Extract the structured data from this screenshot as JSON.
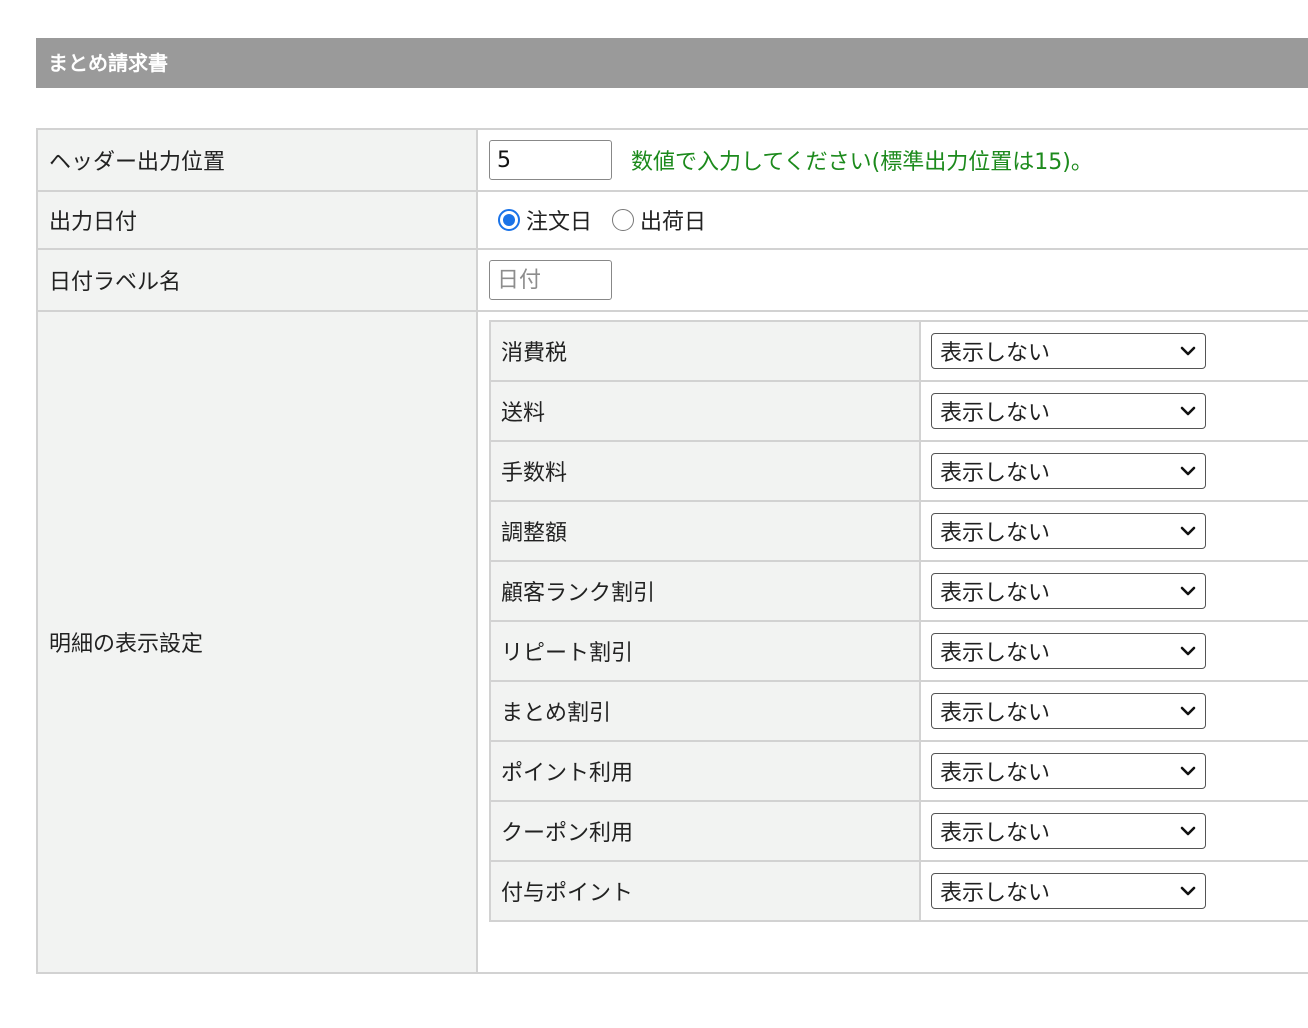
{
  "section": {
    "title": "まとめ請求書"
  },
  "header_position": {
    "label": "ヘッダー出力位置",
    "value": "5",
    "hint": "数値で入力してください(標準出力位置は15)。"
  },
  "output_date": {
    "label": "出力日付",
    "options": [
      {
        "label": "注文日",
        "checked": true
      },
      {
        "label": "出荷日",
        "checked": false
      }
    ]
  },
  "date_label_name": {
    "label": "日付ラベル名",
    "placeholder": "日付"
  },
  "detail_display": {
    "label": "明細の表示設定",
    "items": [
      {
        "label": "消費税",
        "selected": "表示しない"
      },
      {
        "label": "送料",
        "selected": "表示しない"
      },
      {
        "label": "手数料",
        "selected": "表示しない"
      },
      {
        "label": "調整額",
        "selected": "表示しない"
      },
      {
        "label": "顧客ランク割引",
        "selected": "表示しない"
      },
      {
        "label": "リピート割引",
        "selected": "表示しない"
      },
      {
        "label": "まとめ割引",
        "selected": "表示しない"
      },
      {
        "label": "ポイント利用",
        "selected": "表示しない"
      },
      {
        "label": "クーポン利用",
        "selected": "表示しない"
      },
      {
        "label": "付与ポイント",
        "selected": "表示しない"
      }
    ]
  },
  "colors": {
    "header_bg": "#9a9a9a",
    "hint": "#1c8a1c",
    "radio_accent": "#1a73e8",
    "label_bg": "#f2f3f2"
  },
  "icons": {
    "select_arrow": "chevron-down-icon"
  }
}
